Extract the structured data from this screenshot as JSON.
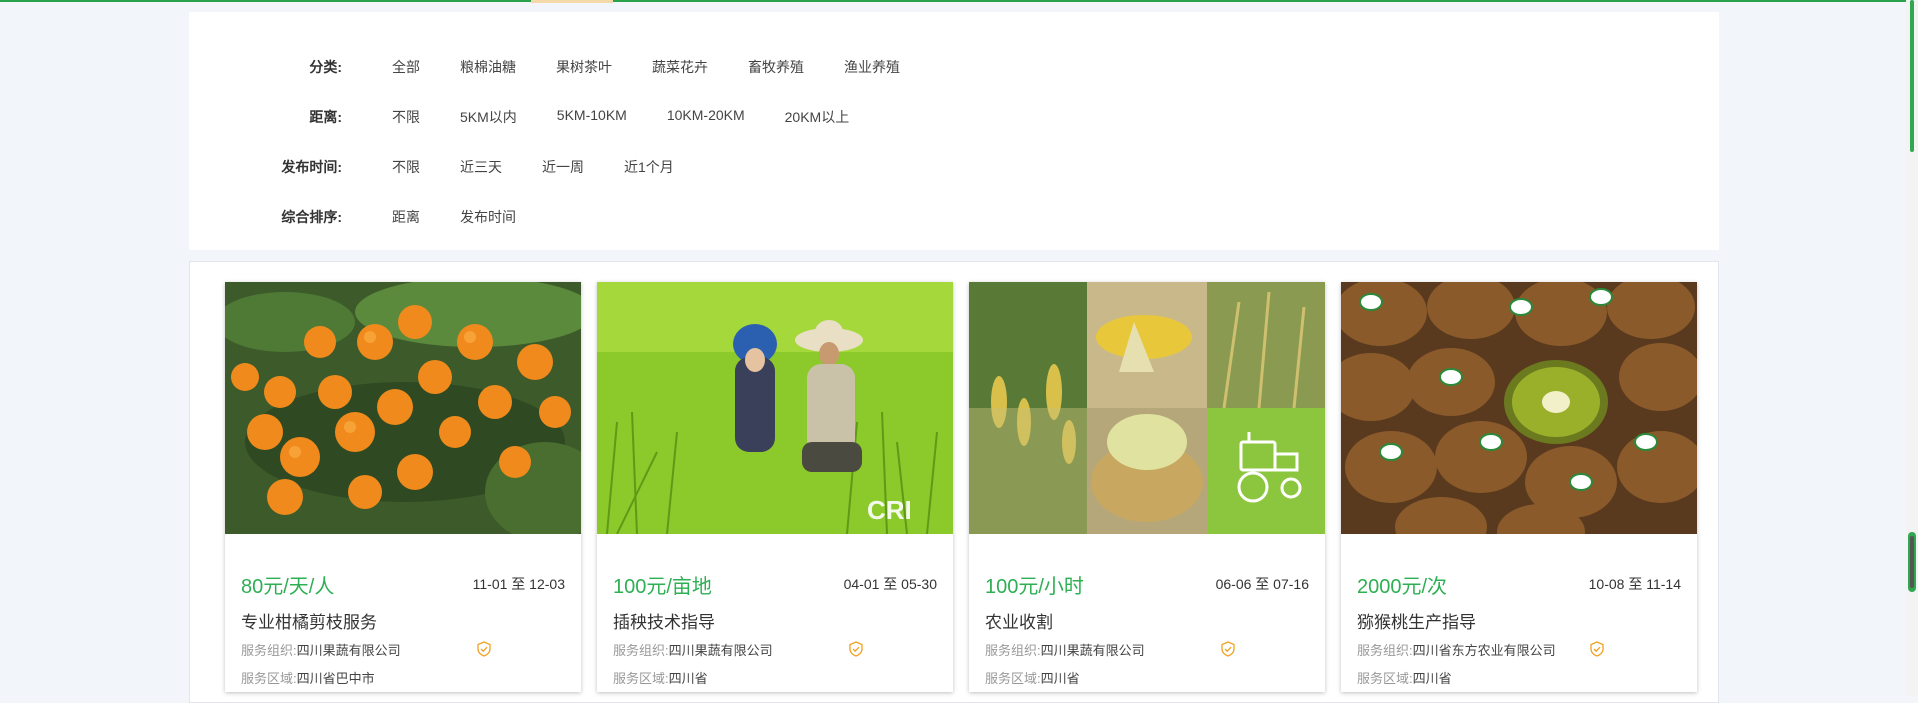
{
  "filters": [
    {
      "label": "分类:",
      "options": [
        "全部",
        "粮棉油糖",
        "果树茶叶",
        "蔬菜花卉",
        "畜牧养殖",
        "渔业养殖"
      ]
    },
    {
      "label": "距离:",
      "options": [
        "不限",
        "5KM以内",
        "5KM-10KM",
        "10KM-20KM",
        "20KM以上"
      ]
    },
    {
      "label": "发布时间:",
      "options": [
        "不限",
        "近三天",
        "近一周",
        "近1个月"
      ]
    },
    {
      "label": "综合排序:",
      "options": [
        "距离",
        "发布时间"
      ]
    }
  ],
  "meta_labels": {
    "org": "服务组织:",
    "region": "服务区域:"
  },
  "services": [
    {
      "price": "80元/天/人",
      "date": "11-01 至 12-03",
      "title": "专业柑橘剪枝服务",
      "org": "四川果蔬有限公司",
      "region": "四川省巴中市",
      "image": "orange-tree-photo"
    },
    {
      "price": "100元/亩地",
      "date": "04-01 至 05-30",
      "title": "插秧技术指导",
      "org": "四川果蔬有限公司",
      "region": "四川省",
      "image": "rice-field-photo",
      "watermark": "CRI"
    },
    {
      "price": "100元/小时",
      "date": "06-06 至 07-16",
      "title": "农业收割",
      "org": "四川果蔬有限公司",
      "region": "四川省",
      "image": "harvest-collage"
    },
    {
      "price": "2000元/次",
      "date": "10-08 至 11-14",
      "title": "猕猴桃生产指导",
      "org": "四川省东方农业有限公司",
      "region": "四川省",
      "image": "kiwi-fruit-photo"
    }
  ],
  "colors": {
    "accent": "#2eaf53",
    "verify": "#f0a020",
    "harvest_green": "#8cc63f"
  }
}
